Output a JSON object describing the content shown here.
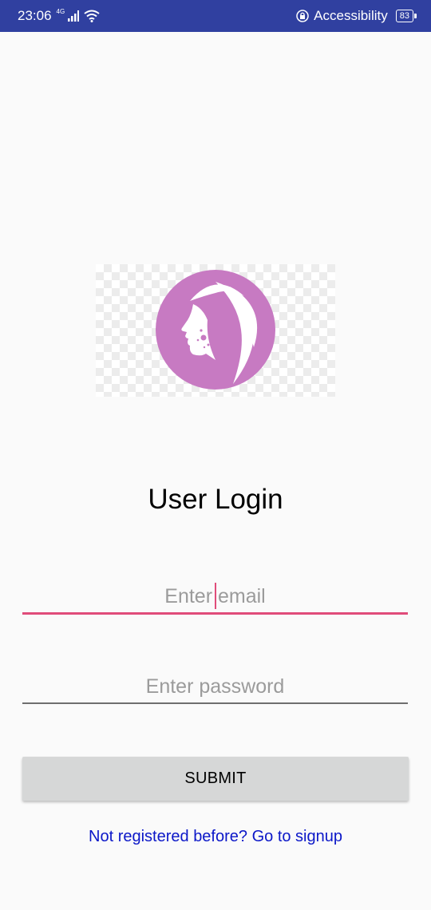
{
  "status_bar": {
    "time": "23:06",
    "network": "4G",
    "accessibility_label": "Accessibility",
    "battery": "83",
    "background": "#3040a0"
  },
  "logo": {
    "circle_color": "#c77ac2",
    "icon": "woman-face-profile-icon"
  },
  "login": {
    "title": "User Login",
    "email_placeholder": "Enter email",
    "password_placeholder": "Enter password",
    "submit_label": "SUBMIT",
    "signup_link": "Not registered before? Go to signup",
    "accent_color": "#e04c7a",
    "link_color": "#0b17c8"
  }
}
